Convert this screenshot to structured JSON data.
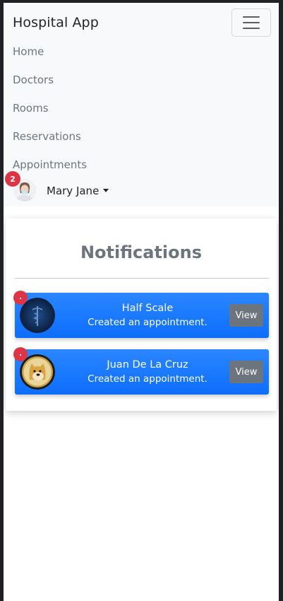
{
  "navbar": {
    "brand": "Hospital App",
    "menu_icon": "hamburger-menu-icon",
    "links": [
      {
        "label": "Home"
      },
      {
        "label": "Doctors"
      },
      {
        "label": "Rooms"
      },
      {
        "label": "Reservations"
      },
      {
        "label": "Appointments"
      }
    ],
    "user": {
      "name": "Mary Jane",
      "notification_count": "2",
      "avatar_icon": "user-avatar-icon"
    }
  },
  "notifications": {
    "title": "Notifications",
    "items": [
      {
        "name": "Half Scale",
        "message": "Created an appointment.",
        "button": "View",
        "dot": ".",
        "avatar_icon": "medical-caduceus-avatar-icon"
      },
      {
        "name": "Juan De La Cruz",
        "message": "Created an appointment.",
        "button": "View",
        "dot": ".",
        "avatar_icon": "doge-coin-avatar-icon"
      }
    ]
  },
  "colors": {
    "primary": "#0d6efd",
    "danger": "#dc3545",
    "secondary": "#6c757d",
    "navbar_bg": "#f8f9fa"
  }
}
